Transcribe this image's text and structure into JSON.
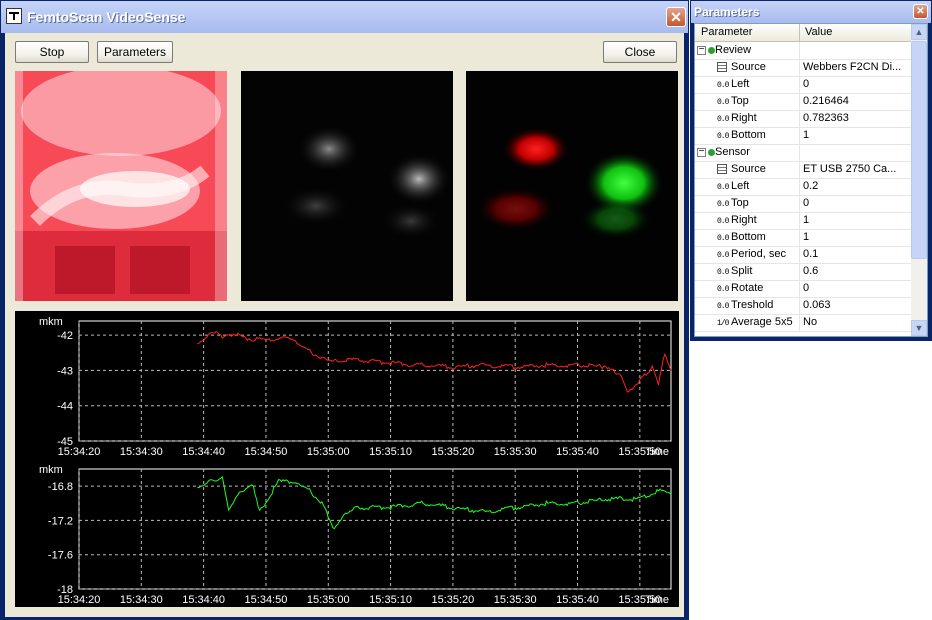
{
  "main_window": {
    "title": "FemtoScan VideoSense",
    "buttons": {
      "stop": "Stop",
      "parameters": "Parameters",
      "close": "Close"
    }
  },
  "graphs": [
    {
      "unit": "mkm",
      "color": "#ff2020",
      "y_ticks": [
        "-42",
        "-43",
        "-44",
        "-45"
      ],
      "x_ticks": [
        "15:34:20",
        "15:34:30",
        "15:34:40",
        "15:34:50",
        "15:35:00",
        "15:35:10",
        "15:35:20",
        "15:35:30",
        "15:35:40",
        "15:35:50"
      ],
      "x_label": "Time"
    },
    {
      "unit": "mkm",
      "color": "#20ff20",
      "y_ticks": [
        "-16.8",
        "-17.2",
        "-17.6",
        "-18"
      ],
      "x_ticks": [
        "15:34:20",
        "15:34:30",
        "15:34:40",
        "15:34:50",
        "15:35:00",
        "15:35:10",
        "15:35:20",
        "15:35:30",
        "15:35:40",
        "15:35:50"
      ],
      "x_label": "Time"
    }
  ],
  "chart_data": [
    {
      "type": "line",
      "ylabel": "mkm",
      "xlabel": "Time",
      "x_range": [
        "15:34:20",
        "15:35:55"
      ],
      "ylim": [
        -45,
        -41.6
      ],
      "grid": true,
      "series": [
        {
          "color": "#ff2020",
          "x": [
            "15:34:39",
            "15:34:41",
            "15:34:42",
            "15:34:43",
            "15:34:45",
            "15:34:47",
            "15:34:50",
            "15:34:53",
            "15:34:55",
            "15:34:57",
            "15:35:00",
            "15:35:05",
            "15:35:10",
            "15:35:15",
            "15:35:20",
            "15:35:25",
            "15:35:30",
            "15:35:35",
            "15:35:40",
            "15:35:44",
            "15:35:47",
            "15:35:48",
            "15:35:50",
            "15:35:52",
            "15:35:53",
            "15:35:54",
            "15:35:55"
          ],
          "values": [
            -42.2,
            -42.0,
            -41.9,
            -42.1,
            -41.95,
            -42.1,
            -42.15,
            -42.05,
            -42.2,
            -42.45,
            -42.75,
            -42.7,
            -42.8,
            -42.85,
            -42.9,
            -42.85,
            -42.9,
            -42.85,
            -42.85,
            -42.9,
            -43.1,
            -43.6,
            -43.3,
            -42.9,
            -43.4,
            -42.5,
            -43.0
          ]
        }
      ]
    },
    {
      "type": "line",
      "ylabel": "mkm",
      "xlabel": "Time",
      "x_range": [
        "15:34:20",
        "15:35:55"
      ],
      "ylim": [
        -18,
        -16.6
      ],
      "grid": true,
      "series": [
        {
          "color": "#20ff20",
          "x": [
            "15:34:39",
            "15:34:41",
            "15:34:43",
            "15:34:44",
            "15:34:46",
            "15:34:48",
            "15:34:49",
            "15:34:52",
            "15:34:55",
            "15:34:57",
            "15:34:59",
            "15:35:01",
            "15:35:03",
            "15:35:05",
            "15:35:10",
            "15:35:15",
            "15:35:20",
            "15:35:25",
            "15:35:30",
            "15:35:35",
            "15:35:40",
            "15:35:45",
            "15:35:50",
            "15:35:53",
            "15:35:55"
          ],
          "values": [
            -16.8,
            -16.75,
            -16.7,
            -17.1,
            -16.85,
            -16.8,
            -17.1,
            -16.75,
            -16.75,
            -16.85,
            -17.0,
            -17.3,
            -17.1,
            -17.05,
            -17.05,
            -17.0,
            -17.05,
            -17.1,
            -17.05,
            -17.0,
            -17.0,
            -16.95,
            -16.95,
            -16.85,
            -16.9
          ]
        }
      ]
    }
  ],
  "parameters_window": {
    "title": "Parameters",
    "columns": {
      "parameter": "Parameter",
      "value": "Value"
    },
    "rows": [
      {
        "kind": "group",
        "name": "Review",
        "value": ""
      },
      {
        "kind": "source",
        "name": "Source",
        "value": "Webbers F2CN Di..."
      },
      {
        "kind": "num",
        "icon": "0.0",
        "name": "Left",
        "value": "0"
      },
      {
        "kind": "num",
        "icon": "0.0",
        "name": "Top",
        "value": "0.216464"
      },
      {
        "kind": "num",
        "icon": "0.0",
        "name": "Right",
        "value": "0.782363"
      },
      {
        "kind": "num",
        "icon": "0.0",
        "name": "Bottom",
        "value": "1"
      },
      {
        "kind": "group",
        "name": "Sensor",
        "value": ""
      },
      {
        "kind": "source",
        "name": "Source",
        "value": "ET USB 2750 Ca..."
      },
      {
        "kind": "num",
        "icon": "0.0",
        "name": "Left",
        "value": "0.2"
      },
      {
        "kind": "num",
        "icon": "0.0",
        "name": "Top",
        "value": "0"
      },
      {
        "kind": "num",
        "icon": "0.0",
        "name": "Right",
        "value": "1"
      },
      {
        "kind": "num",
        "icon": "0.0",
        "name": "Bottom",
        "value": "1"
      },
      {
        "kind": "num",
        "icon": "0.0",
        "name": "Period, sec",
        "value": "0.1"
      },
      {
        "kind": "num",
        "icon": "0.0",
        "name": "Split",
        "value": "0.6"
      },
      {
        "kind": "num",
        "icon": "0.0",
        "name": "Rotate",
        "value": "0"
      },
      {
        "kind": "num",
        "icon": "0.0",
        "name": "Treshold",
        "value": "0.063"
      },
      {
        "kind": "num",
        "icon": "1/0",
        "name": "Average 5x5",
        "value": "No"
      }
    ]
  }
}
